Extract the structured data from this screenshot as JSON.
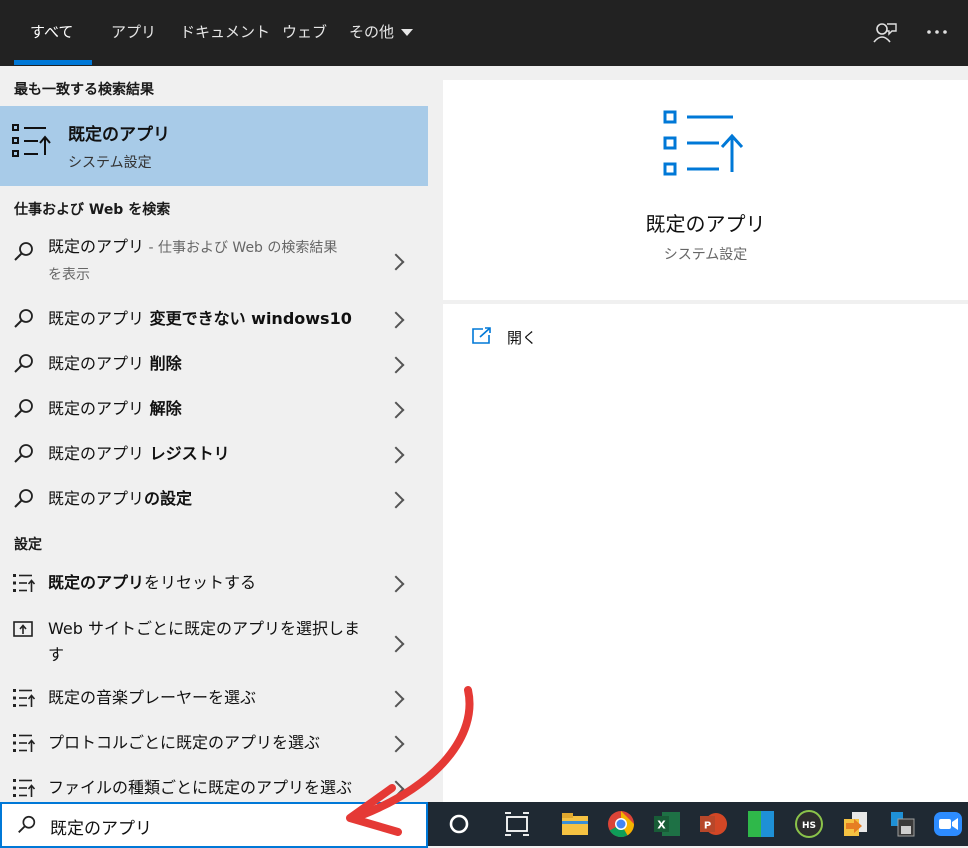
{
  "tabs": [
    {
      "label": "すべて"
    },
    {
      "label": "アプリ"
    },
    {
      "label": "ドキュメント"
    },
    {
      "label": "ウェブ"
    },
    {
      "label": "その他"
    }
  ],
  "colors": {
    "accent": "#0078d7",
    "selection": "#a8cbe8",
    "topbar": "#222222"
  },
  "left": {
    "best_match_header": "最も一致する検索結果",
    "best_match": {
      "title": "既定のアプリ",
      "subtitle": "システム設定"
    },
    "web_header": "仕事および Web を検索",
    "web_items": [
      {
        "main": "既定のアプリ",
        "muted": " - 仕事および Web の検索結果",
        "line2": "を表示"
      },
      {
        "main": "既定のアプリ",
        "bold": " 変更できない windows10"
      },
      {
        "main": "既定のアプリ",
        "bold": " 削除"
      },
      {
        "main": "既定のアプリ",
        "bold": " 解除"
      },
      {
        "main": "既定のアプリ",
        "bold": " レジストリ"
      },
      {
        "main": "既定のアプリ",
        "bold": "の設定"
      }
    ],
    "settings_header": "設定",
    "settings_items": [
      {
        "bold": "既定のアプリ",
        "rest": "をリセットする"
      },
      {
        "line1": "Web サイトごとに既定のアプリを選択しま",
        "line2": "す"
      },
      {
        "rest": "既定の音楽プレーヤーを選ぶ"
      },
      {
        "rest": "プロトコルごとに既定のアプリを選ぶ"
      },
      {
        "rest": "ファイルの種類ごとに既定のアプリを選ぶ"
      }
    ]
  },
  "preview": {
    "title": "既定のアプリ",
    "subtitle": "システム設定",
    "open_label": "開く"
  },
  "search": {
    "value": "既定のアプリ"
  }
}
